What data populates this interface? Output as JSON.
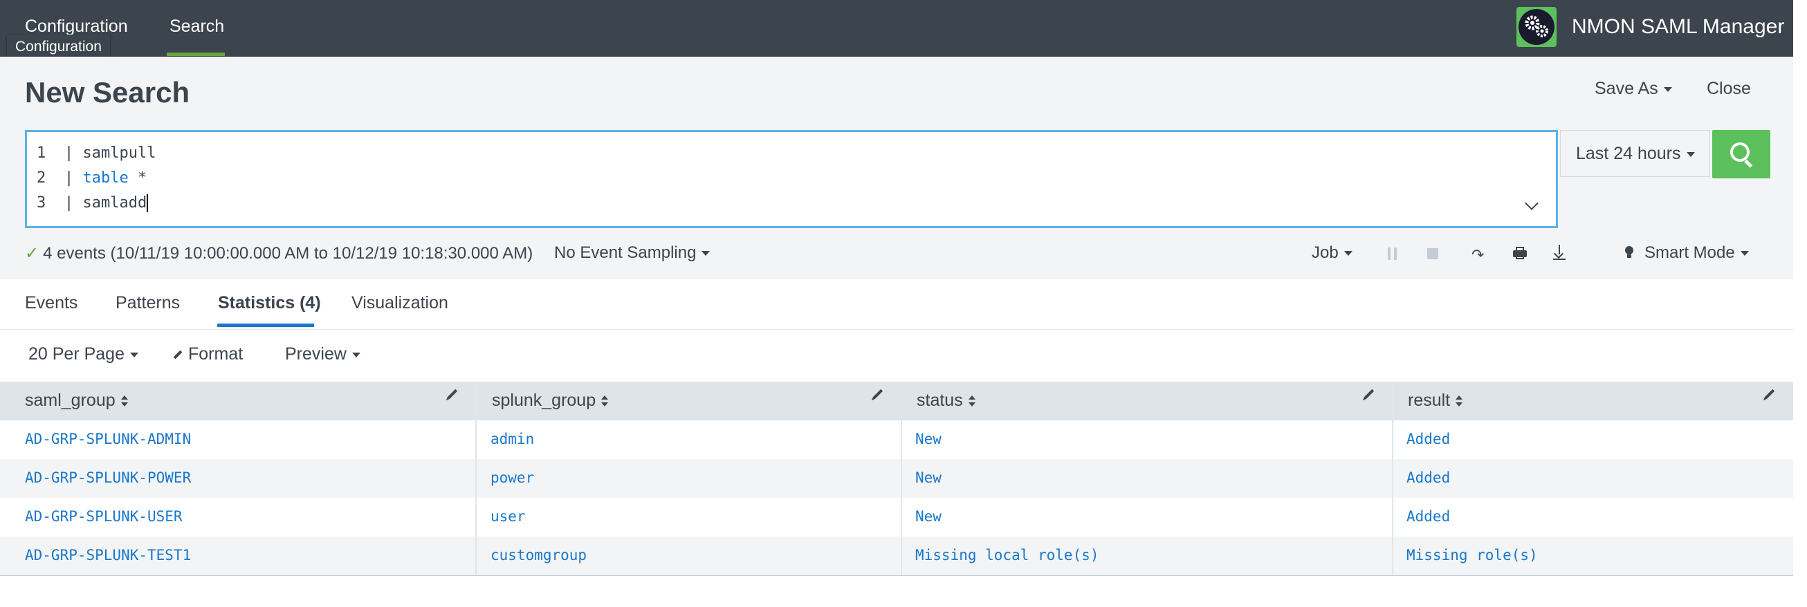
{
  "nav": {
    "items": [
      "Configuration",
      "Search"
    ],
    "tooltip": "Configuration"
  },
  "app": {
    "title": "NMON SAML Manager",
    "logo_icon": "gears-icon"
  },
  "header": {
    "title": "New Search",
    "save_as": "Save As",
    "close": "Close"
  },
  "editor": {
    "line_numbers": [
      "1",
      "2",
      "3"
    ],
    "lines": [
      {
        "pipe": "| ",
        "command": "samlpull",
        "arg": ""
      },
      {
        "pipe": "| ",
        "command": "table",
        "arg": " *"
      },
      {
        "pipe": "| ",
        "command": "samladd",
        "arg": ""
      }
    ]
  },
  "time_picker": {
    "label": "Last 24 hours"
  },
  "status": {
    "events": "4 events (10/11/19 10:00:00.000 AM to 10/12/19 10:18:30.000 AM)",
    "sampling": "No Event Sampling",
    "job": "Job",
    "mode": "Smart Mode"
  },
  "tabs": [
    "Events",
    "Patterns",
    "Statistics (4)",
    "Visualization"
  ],
  "controls": {
    "per_page": "20 Per Page",
    "format": "Format",
    "preview": "Preview"
  },
  "table": {
    "columns": [
      "saml_group",
      "splunk_group",
      "status",
      "result"
    ],
    "rows": [
      [
        "AD-GRP-SPLUNK-ADMIN",
        "admin",
        "New",
        "Added"
      ],
      [
        "AD-GRP-SPLUNK-POWER",
        "power",
        "New",
        "Added"
      ],
      [
        "AD-GRP-SPLUNK-USER",
        "user",
        "New",
        "Added"
      ],
      [
        "AD-GRP-SPLUNK-TEST1",
        "customgroup",
        "Missing local role(s)",
        "Missing role(s)"
      ]
    ]
  },
  "colors": {
    "topbar": "#3c444d",
    "accent_green": "#5cc05c",
    "link_blue": "#1a77c9",
    "editor_border": "#5bb3e5"
  }
}
